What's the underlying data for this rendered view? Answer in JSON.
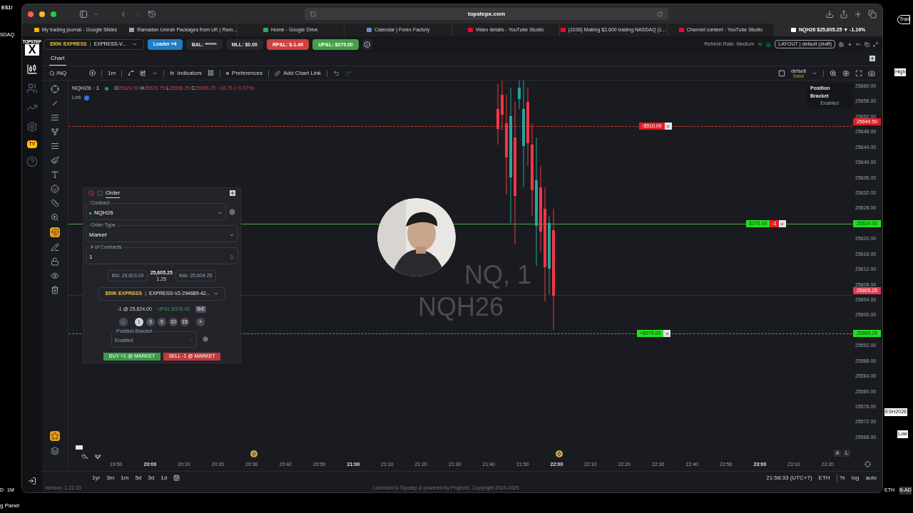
{
  "desktop": {
    "left": [
      "ES1!",
      "SDAQ",
      "D",
      "1M"
    ],
    "right": [
      "Trad",
      "High",
      "ESH2026",
      "Low",
      "ETH",
      "B-AD"
    ],
    "bottom": "g Panel"
  },
  "browser": {
    "url": "topstepx.com",
    "tabs": [
      {
        "label": "My trading journal - Google Slides",
        "selected": false,
        "color": "#f4b400"
      },
      {
        "label": "Ramadan Umrah Packages from UK | Ram...",
        "selected": false,
        "color": "#9ca3af"
      },
      {
        "label": "Home - Google Drive",
        "selected": false,
        "color": "#34a853"
      },
      {
        "label": "Calendar | Forex Factory",
        "selected": false,
        "color": "#6b8fc9"
      },
      {
        "label": "Video details - YouTube Studio",
        "selected": false,
        "color": "#ff0033"
      },
      {
        "label": "(1036) Making $2,600 trading NASDAQ (1...",
        "selected": false,
        "color": "#ff0033"
      },
      {
        "label": "Channel content - YouTube Studio",
        "selected": false,
        "color": "#ff0033"
      },
      {
        "label": "NQH26 $25,605.25 ▼ -1.16%",
        "selected": true,
        "color": "#ffffff"
      }
    ]
  },
  "logo": {
    "top": "TOPSTEP",
    "letter": "X"
  },
  "sidebar_badge": "TV",
  "account_bar": {
    "account_name": "$50K EXPRESS",
    "separator": "|",
    "account_id": "EXPRESS-V...",
    "leader": "Leader +4",
    "bal": "BAL: ******",
    "mll": "MLL: $0.00",
    "rpl": "RP&L: $-1.40",
    "upl": "UP&L: $375.00",
    "refresh": "Refresh Rate: Medium",
    "layout": "LAYOUT | default (draft)"
  },
  "chart_tabs": [
    {
      "label": "Chart",
      "selected": true
    }
  ],
  "toolbar": {
    "symbol": "/NQ",
    "interval": "1m",
    "indicators_icon": "fx",
    "indicators": "Indicators",
    "preferences": "Preferences",
    "add_link": "Add Chart Link",
    "layout_name": "default",
    "save": "Save"
  },
  "legend": {
    "title": "NQH26 · 1",
    "o_label": "O",
    "o": "25624.50",
    "h_label": "H",
    "h": "25626.75",
    "l_label": "L",
    "l": "25596.25",
    "c_label": "C",
    "c": "25605.25",
    "change": "−18.75 (−0.07%)",
    "link": "Link"
  },
  "tooltip": {
    "title": "Position Bracket",
    "value": "Enabled"
  },
  "watermark": [
    "NQ, 1",
    "NQH26"
  ],
  "price_axis": [
    "25660.00",
    "25656.00",
    "25652.00",
    "25648.00",
    "25644.00",
    "25640.00",
    "25636.00",
    "25632.00",
    "25628.00",
    "25620.00",
    "25616.00",
    "25612.00",
    "25608.00",
    "25604.00",
    "25600.00",
    "25592.00",
    "25588.00",
    "25584.00",
    "25580.00",
    "25576.00",
    "25572.00",
    "25568.00"
  ],
  "lines": [
    {
      "kind": "stop",
      "tag": "-$510.00",
      "axis": "25649.50"
    },
    {
      "kind": "entry",
      "tag": "$375.00",
      "qty": "-1",
      "axis": "25624.00"
    },
    {
      "kind": "current",
      "axis": "25605.25"
    },
    {
      "kind": "target",
      "tag": "+$575.00",
      "axis": "25595.25"
    }
  ],
  "order_panel": {
    "title": "Order",
    "contract_label": "Contract",
    "contract": "NQH26",
    "order_type_label": "Order Type",
    "order_type": "Market",
    "contracts_label": "# of Contracts",
    "contracts": "1",
    "bid": "Bid: 25,603.00",
    "last": "25,605.25",
    "spread": "1.25",
    "ask": "Ask: 25,604.25",
    "account_name": "$50K EXPRESS",
    "separator": "|",
    "account_id": "EXPRESS-V2-294689-42...",
    "position": "-1 @ 25,624.00",
    "upl": "UP&L $375.00",
    "be": "B/E",
    "quantities": [
      {
        "label": "-",
        "selected": false
      },
      {
        "label": "1",
        "selected": true
      },
      {
        "label": "3",
        "selected": false
      },
      {
        "label": "5",
        "selected": false
      },
      {
        "label": "10",
        "selected": false
      },
      {
        "label": "15",
        "selected": false
      },
      {
        "label": "+",
        "selected": false
      }
    ],
    "bracket_label": "Position Bracket",
    "bracket": "Enabled",
    "buy": "BUY +1 @ MARKET",
    "sell": "SELL -1 @ MARKET"
  },
  "time_axis": [
    {
      "label": "19:50",
      "major": false
    },
    {
      "label": "20:00",
      "major": true
    },
    {
      "label": "20:10",
      "major": false
    },
    {
      "label": "20:20",
      "major": false
    },
    {
      "label": "20:30",
      "major": false
    },
    {
      "label": "20:40",
      "major": false
    },
    {
      "label": "20:50",
      "major": false
    },
    {
      "label": "21:00",
      "major": true
    },
    {
      "label": "21:10",
      "major": false
    },
    {
      "label": "21:20",
      "major": false
    },
    {
      "label": "21:30",
      "major": false
    },
    {
      "label": "21:40",
      "major": false
    },
    {
      "label": "21:50",
      "major": false
    },
    {
      "label": "22:00",
      "major": true
    },
    {
      "label": "22:10",
      "major": false
    },
    {
      "label": "22:20",
      "major": false
    },
    {
      "label": "22:30",
      "major": false
    },
    {
      "label": "22:40",
      "major": false
    },
    {
      "label": "22:50",
      "major": false
    },
    {
      "label": "23:00",
      "major": true
    },
    {
      "label": "23:10",
      "major": false
    },
    {
      "label": "23:20",
      "major": false
    }
  ],
  "axis_buttons": [
    "A",
    "L"
  ],
  "bottom": {
    "ranges": [
      "1yr",
      "3m",
      "1m",
      "5d",
      "3d",
      "1d"
    ],
    "clock": "21:58:33 (UTC+7)",
    "session": "ETH",
    "percent": "%",
    "log": "log",
    "auto": "auto",
    "version": "Version: 1.22.33",
    "license": "Licensed to Topstep & powered by ProjectX. Copyright 2024-2026"
  }
}
